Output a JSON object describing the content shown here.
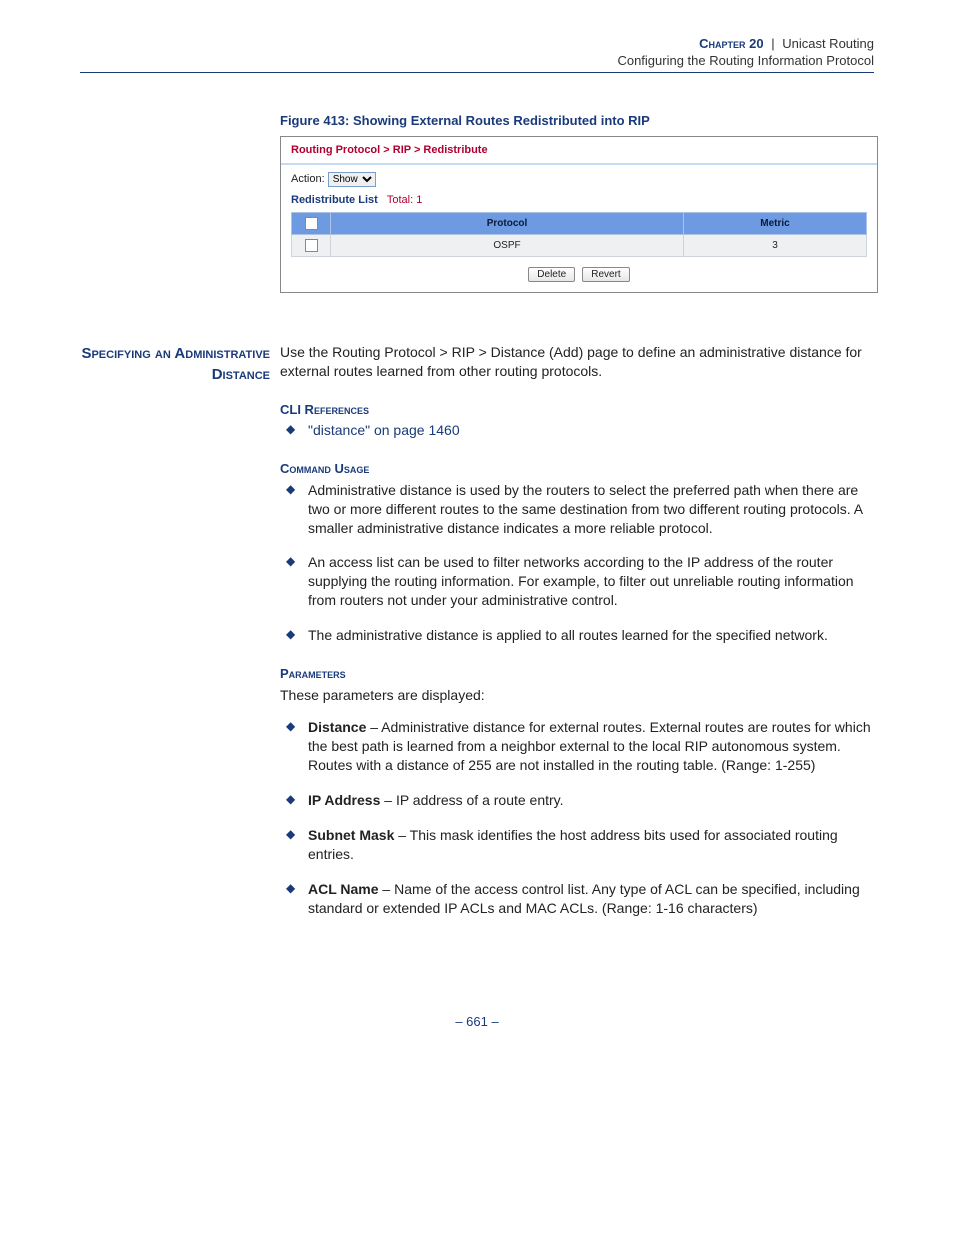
{
  "header": {
    "chapter_label": "Chapter 20",
    "separator": "|",
    "chapter_title": "Unicast Routing",
    "subtitle": "Configuring the Routing Information Protocol"
  },
  "figure": {
    "caption": "Figure 413:  Showing External Routes Redistributed into RIP",
    "breadcrumb": "Routing Protocol > RIP > Redistribute",
    "action_label": "Action:",
    "action_value": "Show",
    "list_heading": "Redistribute List",
    "list_total": "Total: 1",
    "columns": {
      "protocol": "Protocol",
      "metric": "Metric"
    },
    "rows": [
      {
        "protocol": "OSPF",
        "metric": "3"
      }
    ],
    "buttons": {
      "delete": "Delete",
      "revert": "Revert"
    }
  },
  "section": {
    "side_heading": "Specifying an Administrative Distance",
    "intro": "Use the Routing Protocol > RIP > Distance (Add) page to define an administrative distance for external routes learned from other routing protocols.",
    "cli_heading": "CLI References",
    "cli_link": "\"distance\" on page 1460",
    "usage_heading": "Command Usage",
    "usage_items": [
      "Administrative distance is used by the routers to select the preferred path when there are two or more different routes to the same destination from two different routing protocols. A smaller administrative distance indicates a more reliable protocol.",
      "An access list can be used to filter networks according to the IP address of the router supplying the routing information. For example, to filter out unreliable routing information from routers not under your administrative control.",
      "The administrative distance is applied to all routes learned for the specified network."
    ],
    "params_heading": "Parameters",
    "params_intro": "These parameters are displayed:",
    "params": [
      {
        "name": "Distance",
        "desc": " – Administrative distance for external routes. External routes are routes for which the best path is learned from a neighbor external to the local RIP autonomous system. Routes with a distance of 255 are not installed in the routing table. (Range: 1-255)"
      },
      {
        "name": "IP Address",
        "desc": " – IP address of a route entry."
      },
      {
        "name": "Subnet Mask",
        "desc": " – This mask identifies the host address bits used for associated routing entries."
      },
      {
        "name": "ACL Name",
        "desc": " – Name of the access control list. Any type of ACL can be specified, including standard or extended IP ACLs and MAC ACLs. (Range: 1-16 characters)"
      }
    ]
  },
  "footer": {
    "page": "–  661  –"
  }
}
